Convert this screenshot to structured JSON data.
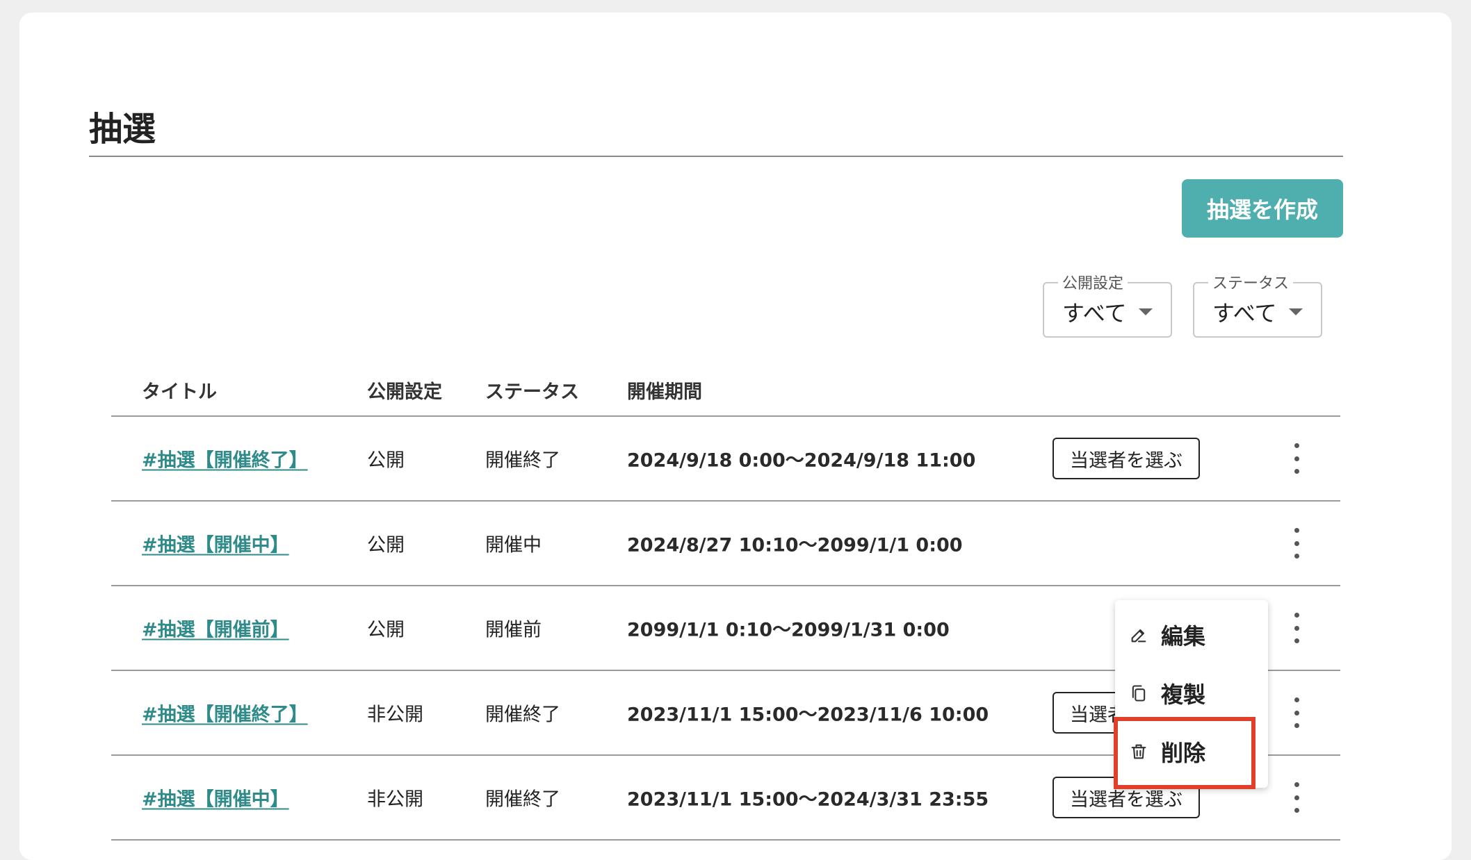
{
  "page": {
    "title": "抽選",
    "create_button": "抽選を作成"
  },
  "filters": {
    "visibility": {
      "label": "公開設定",
      "value": "すべて"
    },
    "status": {
      "label": "ステータス",
      "value": "すべて"
    }
  },
  "table": {
    "headers": [
      "タイトル",
      "公開設定",
      "ステータス",
      "開催期間"
    ],
    "rows": [
      {
        "title": "#抽選【開催終了】",
        "visibility": "公開",
        "status": "開催終了",
        "period": "2024/9/18 0:00〜2024/9/18 11:00",
        "action": "当選者を選ぶ"
      },
      {
        "title": "#抽選【開催中】",
        "visibility": "公開",
        "status": "開催中",
        "period": "2024/8/27 10:10〜2099/1/1 0:00",
        "action": ""
      },
      {
        "title": "#抽選【開催前】",
        "visibility": "公開",
        "status": "開催前",
        "period": "2099/1/1 0:10〜2099/1/31 0:00",
        "action": ""
      },
      {
        "title": "#抽選【開催終了】",
        "visibility": "非公開",
        "status": "開催終了",
        "period": "2023/11/1 15:00〜2023/11/6 10:00",
        "action": "当選者を選ぶ"
      },
      {
        "title": "#抽選【開催中】",
        "visibility": "非公開",
        "status": "開催終了",
        "period": "2023/11/1 15:00〜2024/3/31 23:55",
        "action": "当選者を選ぶ"
      }
    ]
  },
  "context_menu": {
    "items": [
      {
        "label": "編集",
        "icon": "edit-icon"
      },
      {
        "label": "複製",
        "icon": "copy-icon"
      },
      {
        "label": "削除",
        "icon": "trash-icon"
      }
    ]
  },
  "colors": {
    "accent": "#4faeae",
    "link": "#2f8a8a",
    "highlight": "#e0402a"
  }
}
